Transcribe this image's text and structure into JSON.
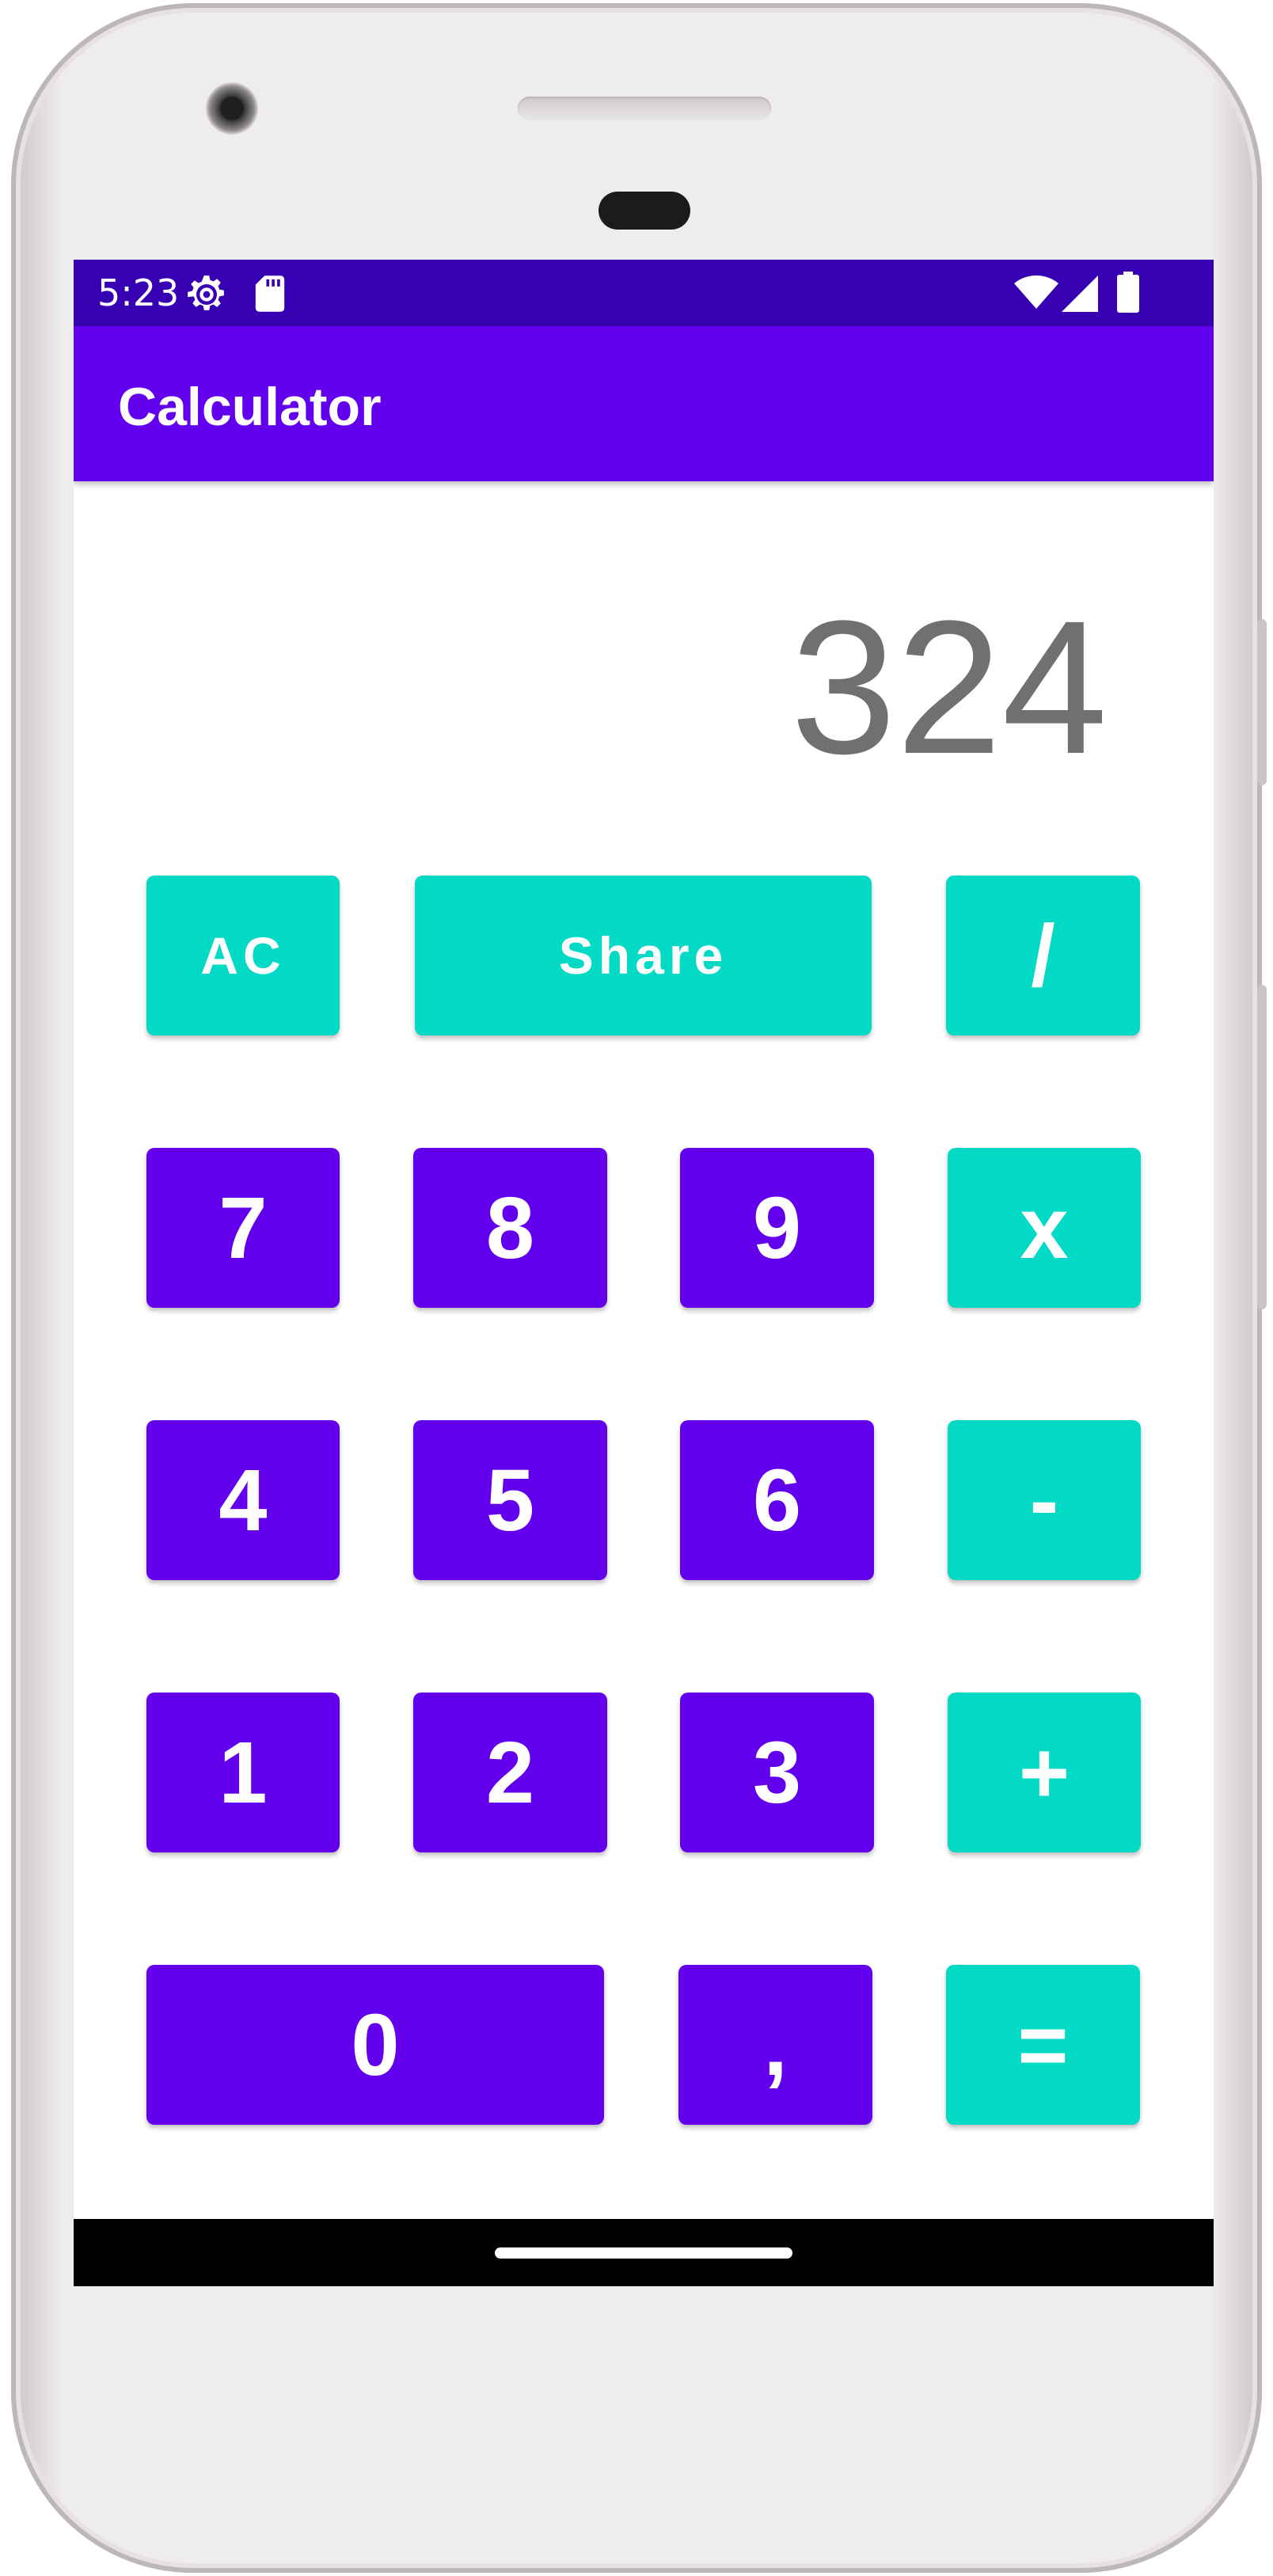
{
  "status_bar": {
    "time": "5:23",
    "left_icons": [
      "gear-icon",
      "sd-card-icon"
    ],
    "right_icons": [
      "wifi-icon",
      "cell-signal-icon",
      "battery-icon"
    ],
    "color": "#3700b3"
  },
  "app_bar": {
    "title": "Calculator",
    "color": "#6200ee"
  },
  "display": {
    "value": "324"
  },
  "buttons": {
    "ac": "AC",
    "share": "Share",
    "divide": "/",
    "seven": "7",
    "eight": "8",
    "nine": "9",
    "multiply": "x",
    "four": "4",
    "five": "5",
    "six": "6",
    "subtract": "-",
    "one": "1",
    "two": "2",
    "three": "3",
    "add": "+",
    "zero": "0",
    "decimal": ",",
    "equals": "="
  },
  "colors": {
    "number_button": "#6200ee",
    "operator_button": "#03dac5",
    "display_text": "#707070"
  },
  "navigation_bar": {
    "icons": [
      "home-pill-icon"
    ]
  }
}
